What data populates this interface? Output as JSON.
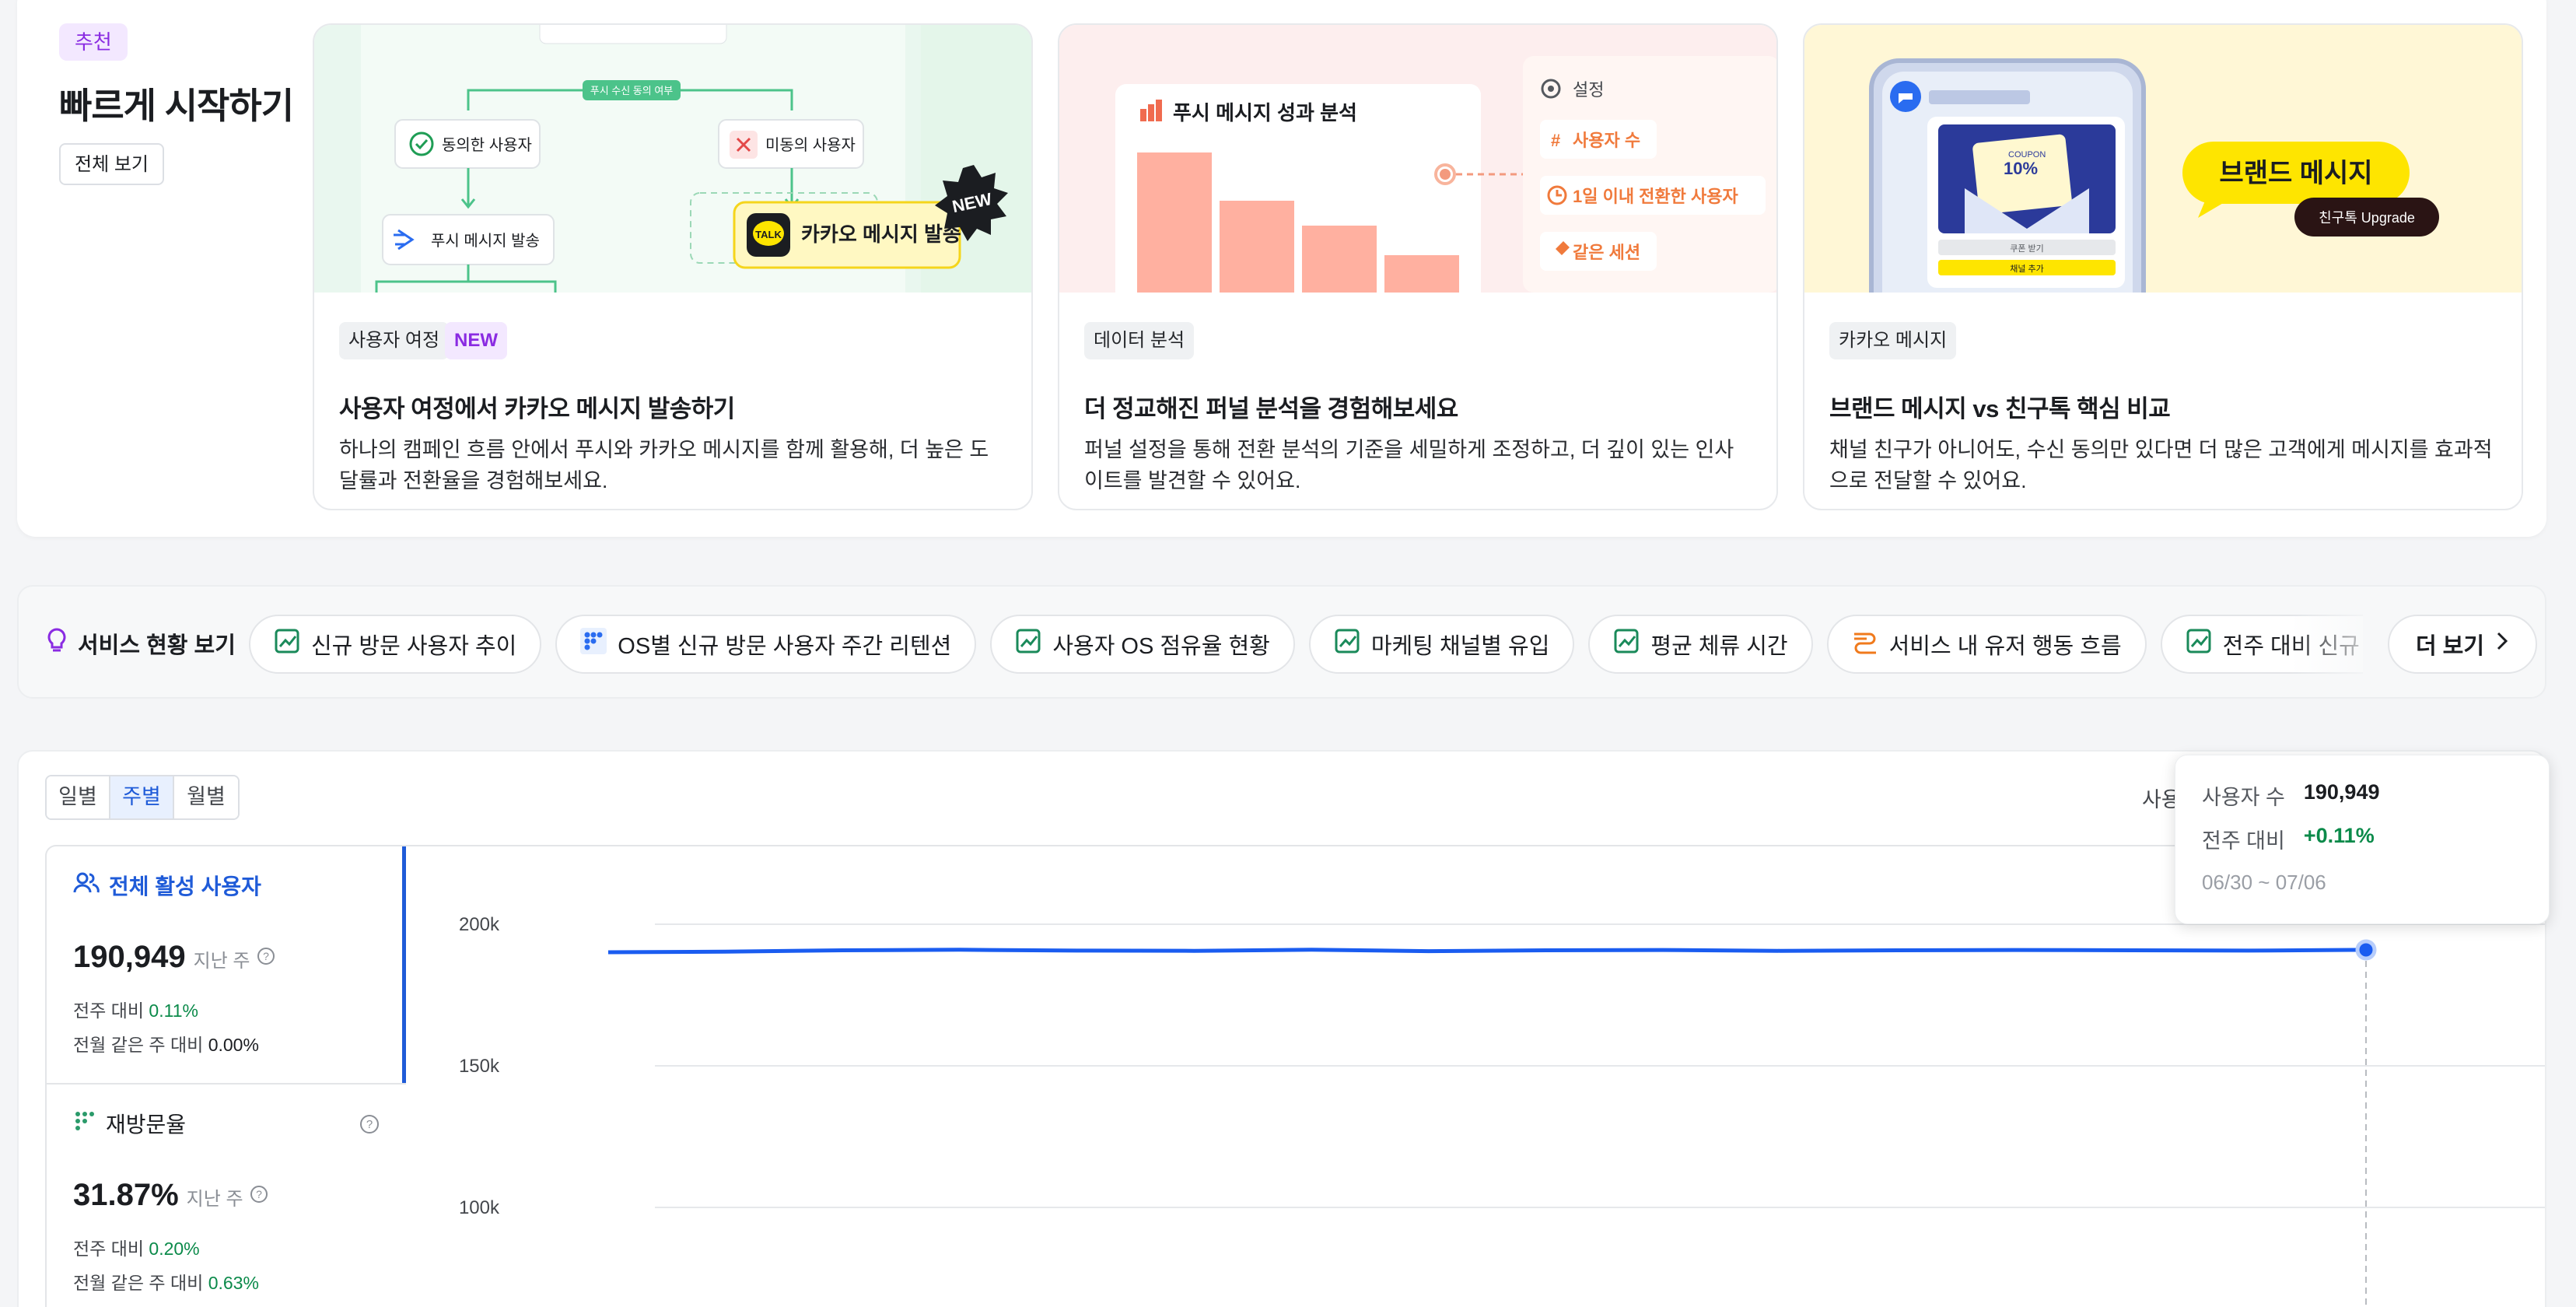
{
  "quick_start": {
    "badge": "추천",
    "title": "빠르게 시작하기",
    "view_all": "전체 보기",
    "cards": [
      {
        "tag": "사용자 여정",
        "new_badge": "NEW",
        "title": "사용자 여정에서 카카오 메시지 발송하기",
        "desc": "하나의 캠페인 흐름 안에서 푸시와 카카오 메시지를 함께 활용해, 더 높은 도달률과 전환율을 경험해보세요.",
        "illust": {
          "consent_label": "푸시 수신 동의 여부",
          "agreed": "동의한 사용자",
          "not_agreed": "미동의 사용자",
          "push_send": "푸시 메시지 발송",
          "kakao_send": "카카오 메시지 발송",
          "talk": "TALK",
          "new_stamp": "NEW"
        }
      },
      {
        "tag": "데이터 분석",
        "title": "더 정교해진 퍼널 분석을 경험해보세요",
        "desc": "퍼널 설정을 통해 전환 분석의 기준을 세밀하게 조정하고, 더 깊이 있는 인사이트를 발견할 수 있어요.",
        "illust": {
          "chart_title": "푸시 메시지 성과 분석",
          "settings": "설정",
          "opt1": "사용자 수",
          "opt2": "1일 이내 전환한 사용자",
          "opt3": "같은 세션"
        }
      },
      {
        "tag": "카카오 메시지",
        "title": "브랜드 메시지 vs 친구톡 핵심 비교",
        "desc": "채널 친구가 아니어도, 수신 동의만 있다면 더 많은 고객에게 메시지를 효과적으로 전달할 수 있어요.",
        "illust": {
          "bubble": "브랜드 메시지",
          "upgrade": "친구톡 Upgrade",
          "coupon": "10%",
          "coupon_top": "COUPON",
          "btn1": "쿠폰 받기",
          "btn2": "채널 추가"
        }
      }
    ]
  },
  "service": {
    "label": "서비스 현황 보기",
    "chips": [
      {
        "label": "신규 방문 사용자 추이",
        "icon": "line-chart-icon"
      },
      {
        "label": "OS별 신규 방문 사용자 주간 리텐션",
        "icon": "grid-dots-icon"
      },
      {
        "label": "사용자 OS 점유율 현황",
        "icon": "line-chart-icon"
      },
      {
        "label": "마케팅 채널별 유입",
        "icon": "line-chart-icon"
      },
      {
        "label": "평균 체류 시간",
        "icon": "line-chart-icon"
      },
      {
        "label": "서비스 내 유저 행동 흐름",
        "icon": "flow-icon"
      },
      {
        "label": "전주 대비 신규 방문 사용자 추이",
        "icon": "line-chart-icon"
      }
    ],
    "more": "더 보기"
  },
  "dashboard": {
    "tabs": [
      "일별",
      "주별",
      "월별"
    ],
    "active_tab": "주별",
    "sort_label": "사용",
    "metrics": [
      {
        "name": "전체 활성 사용자",
        "value": "190,949",
        "period": "지난 주",
        "row1_label": "전주 대비",
        "row1_value": "0.11%",
        "row2_label": "전월 같은 주 대비",
        "row2_value": "0.00%"
      },
      {
        "name": "재방문율",
        "value": "31.87%",
        "period": "지난 주",
        "row1_label": "전주 대비",
        "row1_value": "0.20%",
        "row2_label": "전월 같은 주 대비",
        "row2_value": "0.63%"
      }
    ],
    "tooltip": {
      "users_label": "사용자 수",
      "users_value": "190,949",
      "wow_label": "전주 대비",
      "wow_value": "+0.11%",
      "date_range": "06/30 ~ 07/06"
    }
  },
  "chart_data": {
    "type": "line",
    "title": "",
    "ylim": [
      0,
      220000
    ],
    "y_ticks": [
      "200k",
      "150k",
      "100k"
    ],
    "y_tick_values": [
      200000,
      150000,
      100000
    ],
    "series": [
      {
        "name": "전체 활성 사용자",
        "color": "#1a5cf0",
        "values": [
          190100,
          190300,
          190800,
          191000,
          190700,
          190600,
          191000,
          190500,
          190800,
          190900,
          190600,
          190800,
          190900,
          190800,
          190700,
          190949
        ]
      }
    ],
    "highlight_index": 15,
    "grid": true
  }
}
